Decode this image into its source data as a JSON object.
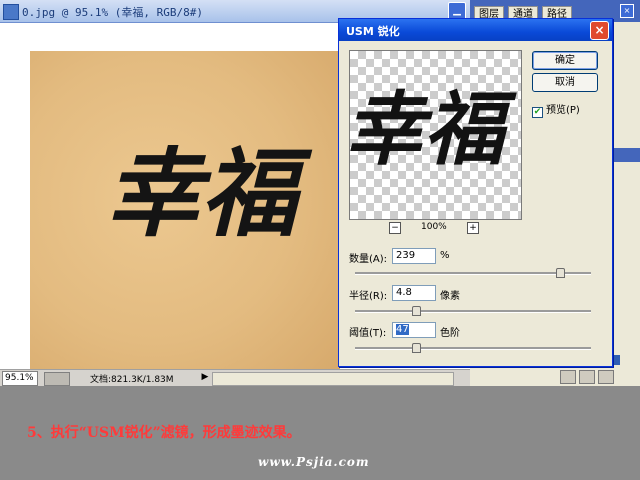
{
  "document": {
    "title": "0.jpg @ 95.1% (幸福, RGB/8#)",
    "zoom": "95.1%",
    "doc_info": "文档:821.3K/1.83M",
    "artwork_text": "幸福"
  },
  "panels": {
    "tabs": [
      "图层",
      "通道",
      "路径"
    ]
  },
  "dialog": {
    "title": "USM 锐化",
    "ok_label": "确定",
    "cancel_label": "取消",
    "preview_label": "预览(P)",
    "preview_checked": true,
    "preview_zoom": "100%",
    "preview_text": "幸福",
    "amount": {
      "label": "数量(A):",
      "value": "239",
      "unit": "%",
      "slider_fraction": 0.87
    },
    "radius": {
      "label": "半径(R):",
      "value": "4.8",
      "unit": "像素",
      "slider_fraction": 0.26
    },
    "threshold": {
      "label": "阈值(T):",
      "value": "47",
      "unit": "色阶",
      "slider_fraction": 0.26
    }
  },
  "caption": "5、执行“USM锐化”滤镜，形成墨迹效果。",
  "watermark": "www.Psjia.com"
}
